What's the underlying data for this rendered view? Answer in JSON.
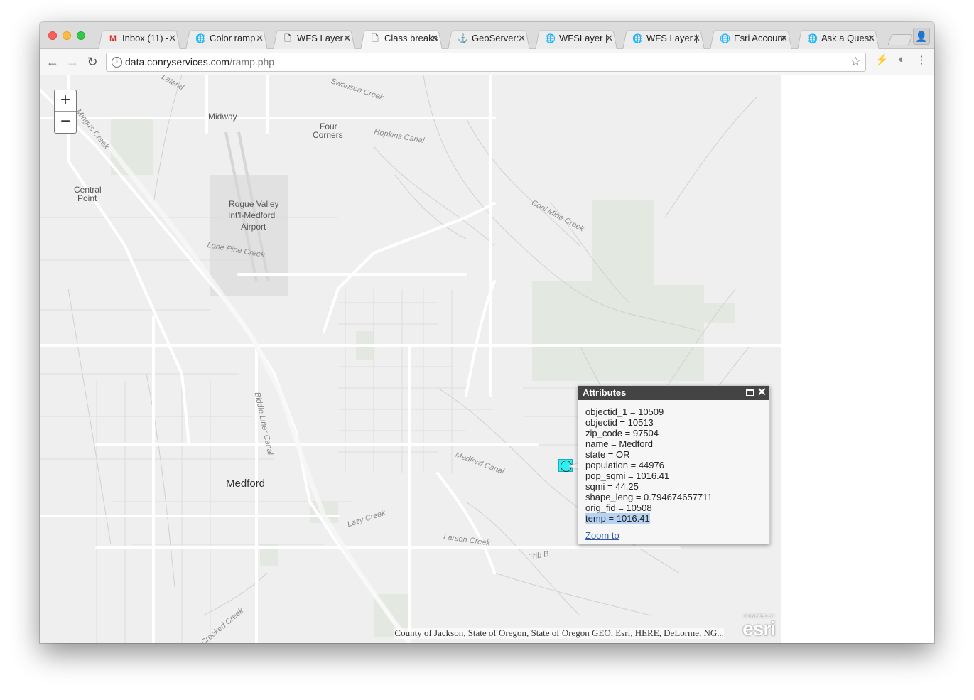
{
  "browser": {
    "tabs": [
      {
        "label": "Inbox (11) -",
        "icon": "gmail-icon",
        "active": false
      },
      {
        "label": "Color ramp",
        "icon": "globe-icon",
        "active": false
      },
      {
        "label": "WFS Layer",
        "icon": "page-icon",
        "active": false
      },
      {
        "label": "Class breaks",
        "icon": "page-icon",
        "active": true
      },
      {
        "label": "GeoServer:",
        "icon": "geoserver-icon",
        "active": false
      },
      {
        "label": "WFSLayer |",
        "icon": "globe-icon",
        "active": false
      },
      {
        "label": "WFS Layer |",
        "icon": "globe-icon",
        "active": false
      },
      {
        "label": "Esri Account",
        "icon": "esri-globe-icon",
        "active": false
      },
      {
        "label": "Ask a Quest",
        "icon": "esri-globe-icon",
        "active": false
      }
    ],
    "url_host": "data.conryservices.com",
    "url_path": "/ramp.php"
  },
  "map": {
    "zoom_in": "+",
    "zoom_out": "−",
    "places": {
      "midway": "Midway",
      "four": "Four",
      "corners": "Corners",
      "central": "Central",
      "point": "Point",
      "airport1": "Rogue Valley",
      "airport2": "Int'l-Medford",
      "airport3": "Airport",
      "medford": "Medford"
    },
    "water": {
      "swanson": "Swanson Creek",
      "hopkins": "Hopkins Canal",
      "mingus": "Mingus Creek",
      "lone_pine": "Lone Pine Creek",
      "biddle": "Biddle Liner Canal",
      "cool_mine": "Cool Mine Creek",
      "medford_canal": "Medford Canal",
      "lazy": "Lazy Creek",
      "larson": "Larson Creek",
      "trib": "Trib B",
      "crooked": "Crooked Creek",
      "lateral": "Lateral"
    },
    "attribution": "County of Jackson, State of Oregon, State of Oregon GEO, Esri, HERE, DeLorme, NG...",
    "esri_powered": "POWERED BY",
    "esri_logo": "esri"
  },
  "popup": {
    "title": "Attributes",
    "rows": [
      "objectid_1 = 10509",
      "objectid = 10513",
      "zip_code = 97504",
      "name = Medford",
      "state = OR",
      "population = 44976",
      "pop_sqmi = 1016.41",
      "sqmi = 44.25",
      "shape_leng = 0.794674657711",
      "orig_fid = 10508"
    ],
    "highlighted_row": "temp = 1016.41",
    "zoom_link": "Zoom to"
  }
}
